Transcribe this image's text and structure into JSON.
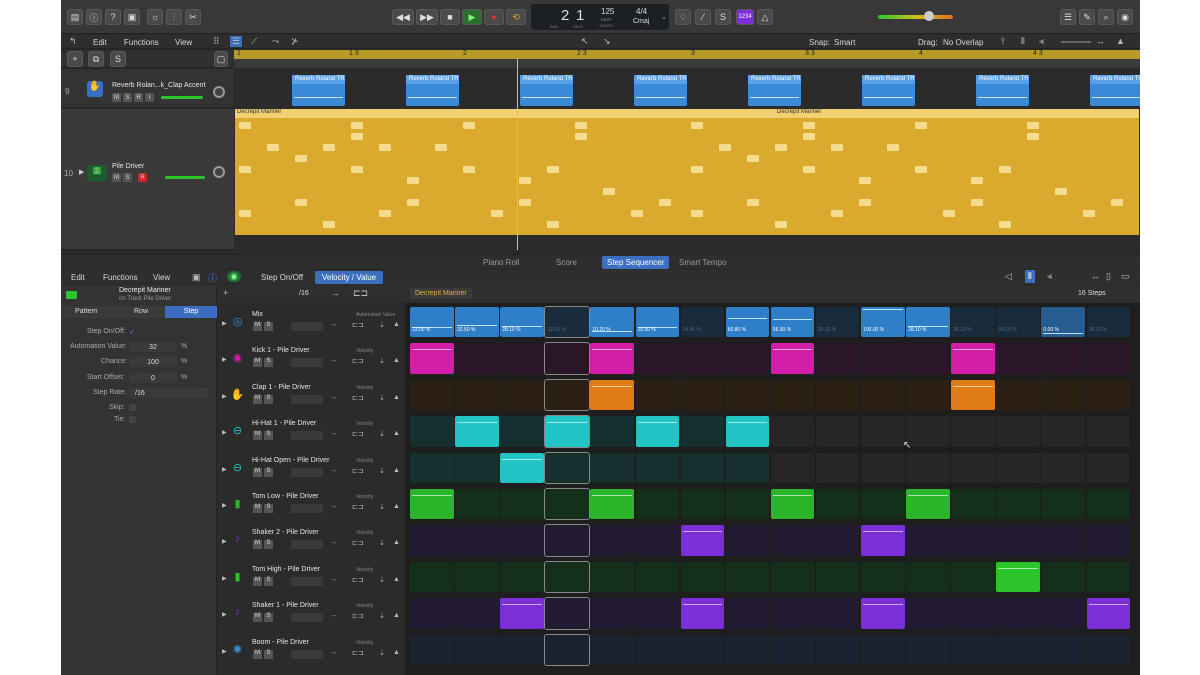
{
  "transport": {
    "bar": "2",
    "beat": "1",
    "bar_label": "BAR",
    "beat_label": "BEAT",
    "tempo": "125",
    "tempo_mode": "KEEP",
    "tempo_label": "TEMPO",
    "signature": "4/4",
    "key": "Cmaj",
    "count_in": "1234"
  },
  "tracks_header": {
    "edit": "Edit",
    "functions": "Functions",
    "view": "View",
    "snap_label": "Snap:",
    "snap_value": "Smart",
    "drag_label": "Drag:",
    "drag_value": "No Overlap",
    "solo_btn": "S"
  },
  "ruler": [
    "1",
    "1 3",
    "2",
    "2 3",
    "3",
    "3 3",
    "4",
    "4 3"
  ],
  "tracks": [
    {
      "num": "9",
      "name": "Reverb Rolan...k_Clap Accent",
      "buttons": [
        "M",
        "S",
        "R",
        "I"
      ]
    },
    {
      "num": "10",
      "name": "Pile Driver",
      "buttons": [
        "M",
        "S",
        "R"
      ]
    }
  ],
  "reverb_region_label": "Reverb Roland TR",
  "pattern_regions": [
    "Decrepit Mariner",
    "Decrepit Mariner"
  ],
  "editor_tabs": [
    "Piano Roll",
    "Score",
    "Step Sequencer",
    "Smart Tempo"
  ],
  "seq_header": {
    "edit": "Edit",
    "functions": "Functions",
    "view": "View",
    "step_onoff": "Step On/Off",
    "velocity": "Velocity / Value"
  },
  "inspector": {
    "pattern_name": "Decrepit Mariner",
    "track_sub": "on Track Pile Driver",
    "tabs": [
      "Pattern",
      "Row",
      "Step"
    ],
    "fields": [
      {
        "label": "Step On/Off:",
        "value": "✓",
        "unit": ""
      },
      {
        "label": "Automation Value:",
        "value": "32",
        "unit": "%"
      },
      {
        "label": "Chance:",
        "value": "100",
        "unit": "%"
      },
      {
        "label": "Start Offset:",
        "value": "0",
        "unit": "%"
      },
      {
        "label": "Step Rate:",
        "value": "/16",
        "unit": ""
      },
      {
        "label": "Skip:",
        "value": "",
        "unit": ""
      },
      {
        "label": "Tie:",
        "value": "",
        "unit": ""
      }
    ]
  },
  "rows_toolbar": {
    "rate": "/16",
    "pattern_name": "Decrepit Mariner",
    "steps": "16 Steps"
  },
  "lanes": [
    {
      "name": "Mix",
      "param": "Automation Value",
      "color": "#3b8fd6"
    },
    {
      "name": "Kick 1 - Pile Driver",
      "param": "Velocity",
      "color": "#d21ea7"
    },
    {
      "name": "Clap 1 - Pile Driver",
      "param": "Velocity",
      "color": "#e07d18"
    },
    {
      "name": "Hi-Hat 1 - Pile Driver",
      "param": "Velocity",
      "color": "#22c4c6"
    },
    {
      "name": "Hi-Hat Open - Pile Driver",
      "param": "Velocity",
      "color": "#22c4c6"
    },
    {
      "name": "Tom Low - Pile Driver",
      "param": "Velocity",
      "color": "#2bb52b"
    },
    {
      "name": "Shaker 2 - Pile Driver",
      "param": "Velocity",
      "color": "#7a2fd8"
    },
    {
      "name": "Tom High - Pile Driver",
      "param": "Velocity",
      "color": "#2bc42b"
    },
    {
      "name": "Shaker 1 - Pile Driver",
      "param": "Velocity",
      "color": "#7a2fd8"
    },
    {
      "name": "Boom - Pile Driver",
      "param": "Velocity",
      "color": "#3b8fd6"
    }
  ],
  "mix_values": [
    "23.00 %",
    "32.50 %",
    "28.10 %",
    "32.50 %",
    "10.20 %",
    "25.00 %",
    "14.40 %",
    "60.80 %",
    "56.30 %",
    "28.10 %",
    "100.00 %",
    "28.10 %",
    "28.10 %",
    "28.10 %",
    "0.00 %",
    "28.10 %"
  ],
  "mix_levels": [
    0.23,
    0.325,
    0.281,
    0.325,
    0.102,
    0.25,
    0.144,
    0.608,
    0.563,
    0.281,
    1.0,
    0.281,
    0.281,
    0.281,
    0.0,
    0.281
  ],
  "mix_on": [
    1,
    1,
    1,
    0,
    1,
    1,
    0,
    1,
    1,
    0,
    1,
    1,
    0,
    0,
    1,
    0
  ],
  "lane_steps": [
    [],
    [
      0,
      4,
      8,
      12
    ],
    [
      4,
      12
    ],
    [
      1,
      3,
      5,
      7
    ],
    [
      2
    ],
    [
      0,
      4,
      8,
      11
    ],
    [
      6,
      10
    ],
    [
      13
    ],
    [
      2,
      6,
      10,
      15
    ],
    []
  ],
  "lane_active_len": [
    16,
    16,
    16,
    8,
    8,
    16,
    16,
    16,
    16,
    16
  ]
}
